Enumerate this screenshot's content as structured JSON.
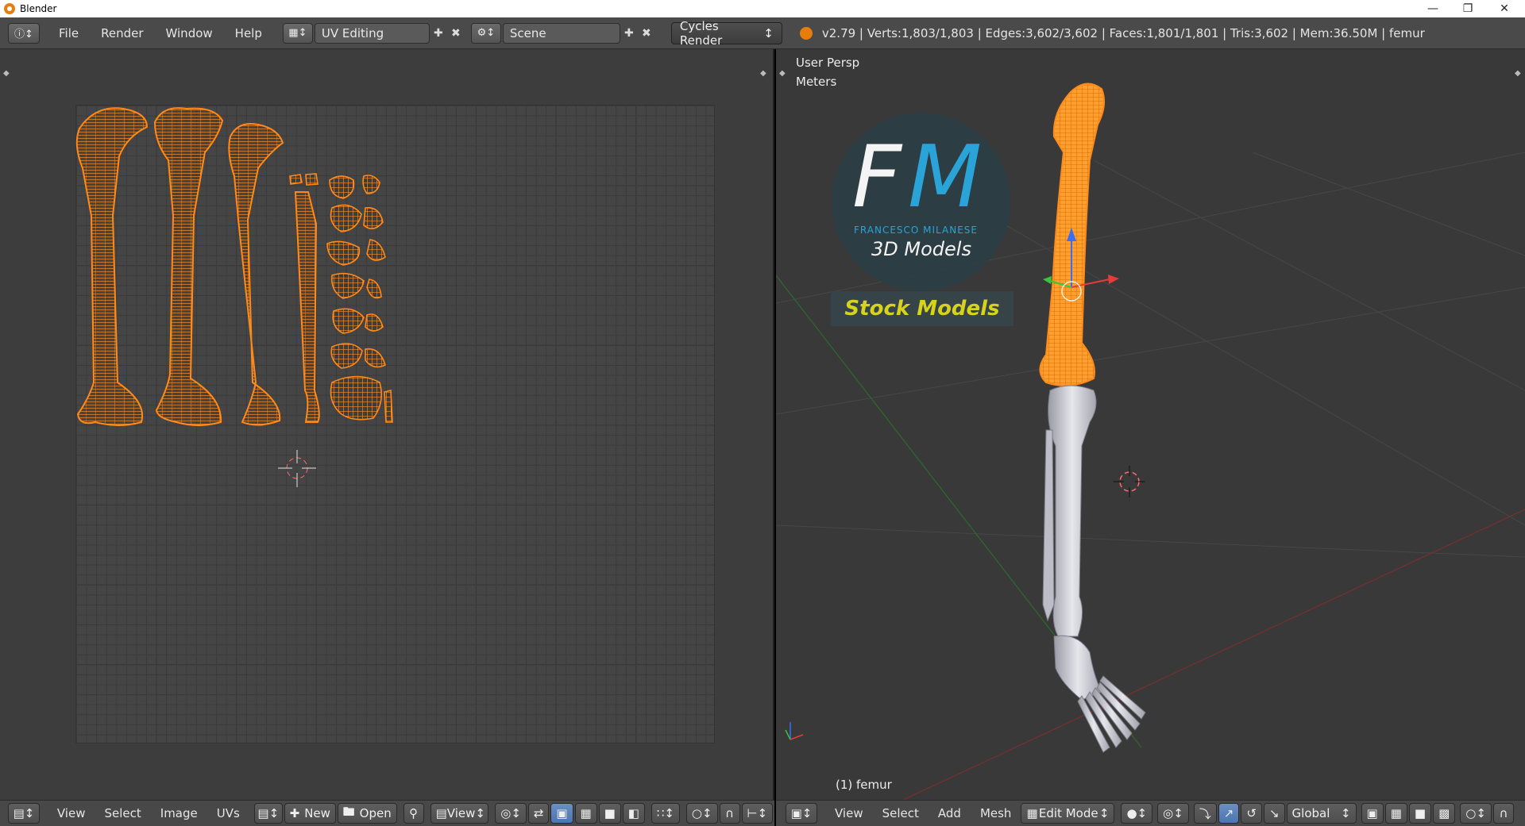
{
  "window": {
    "title": "Blender"
  },
  "infobar": {
    "menus": [
      "File",
      "Render",
      "Window",
      "Help"
    ],
    "screen_layout": "UV Editing",
    "scene": "Scene",
    "render_engine": "Cycles Render",
    "stats": "v2.79 | Verts:1,803/1,803 | Edges:3,602/3,602 | Faces:1,801/1,801 | Tris:3,602 | Mem:36.50M | femur"
  },
  "view3d": {
    "perspective_label": "User Persp",
    "units_label": "Meters",
    "object_label": "(1) femur",
    "menus": [
      "View",
      "Select",
      "Add",
      "Mesh"
    ],
    "mode": "Edit Mode",
    "orientation": "Global"
  },
  "uv_editor": {
    "menus": [
      "View",
      "Select",
      "Image",
      "UVs"
    ],
    "new_label": "New",
    "open_label": "Open",
    "view_label": "View"
  },
  "watermark": {
    "letter_f": "F",
    "letter_m": "M",
    "name": "FRANCESCO MILANESE",
    "subtitle": "3D Models",
    "stock": "Stock Models"
  },
  "colors": {
    "selection": "#ff8a1a",
    "bone": "#d6d6de",
    "accent_blue": "#29a9e1",
    "stock_yellow": "#d7d21b"
  }
}
